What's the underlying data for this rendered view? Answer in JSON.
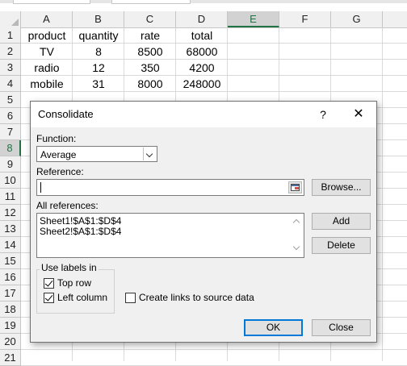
{
  "sheet": {
    "columns": [
      "A",
      "B",
      "C",
      "D",
      "E",
      "F",
      "G"
    ],
    "selected_column": "E",
    "rows": [
      "1",
      "2",
      "3",
      "4",
      "5",
      "6",
      "7",
      "8",
      "9",
      "10",
      "11",
      "12",
      "13",
      "14",
      "15",
      "16",
      "17",
      "18",
      "19",
      "20",
      "21"
    ],
    "selected_row": "8",
    "cells": [
      [
        "product",
        "quantity",
        "rate",
        "total"
      ],
      [
        "TV",
        "8",
        "8500",
        "68000"
      ],
      [
        "radio",
        "12",
        "350",
        "4200"
      ],
      [
        "mobile",
        "31",
        "8000",
        "248000"
      ]
    ]
  },
  "dialog": {
    "title": "Consolidate",
    "help_label": "?",
    "close_label": "✕",
    "function_label": "Function:",
    "function_value": "Average",
    "reference_label": "Reference:",
    "reference_value": "",
    "browse_label": "Browse...",
    "all_references_label": "All references:",
    "all_references": [
      "Sheet1!$A$1:$D$4",
      "Sheet2!$A$1:$D$4"
    ],
    "add_label": "Add",
    "delete_label": "Delete",
    "use_labels_in_label": "Use labels in",
    "top_row_label": "Top row",
    "top_row_checked": true,
    "left_column_label": "Left column",
    "left_column_checked": true,
    "create_links_label": "Create links to source data",
    "create_links_checked": false,
    "ok_label": "OK",
    "close_button_label": "Close"
  }
}
